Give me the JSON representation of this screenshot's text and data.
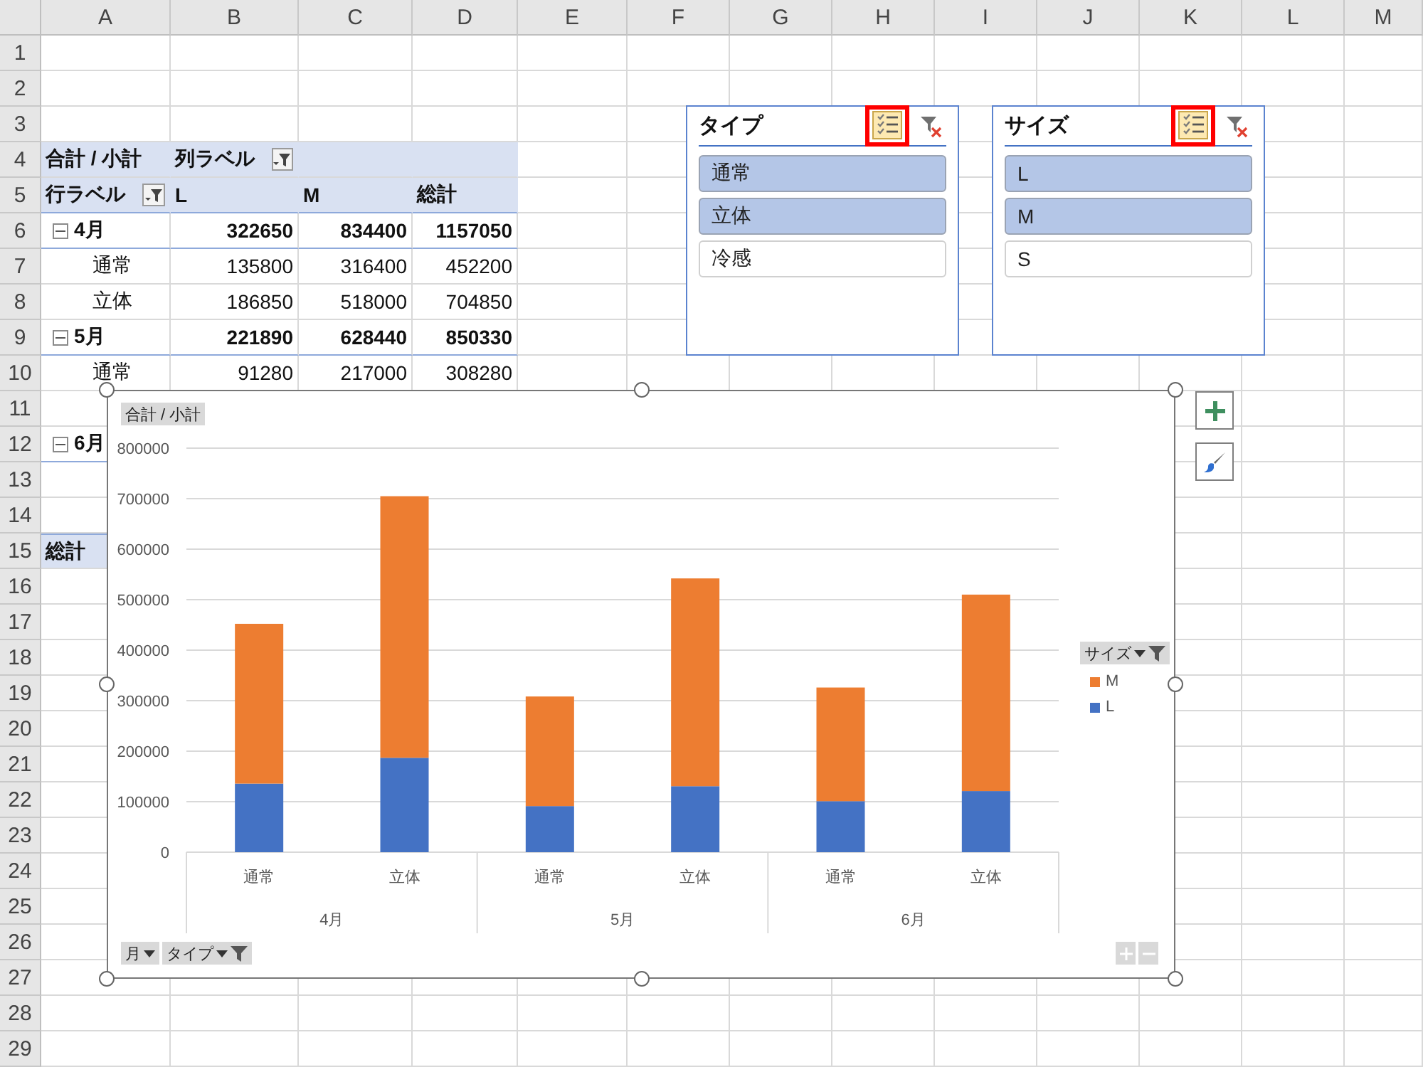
{
  "sheet": {
    "columns": [
      "A",
      "B",
      "C",
      "D",
      "E",
      "F",
      "G",
      "H",
      "I",
      "J",
      "K",
      "L",
      "M"
    ],
    "rows": [
      "1",
      "2",
      "3",
      "4",
      "5",
      "6",
      "7",
      "8",
      "9",
      "10",
      "11",
      "12",
      "13",
      "14",
      "15",
      "16",
      "17",
      "18",
      "19",
      "20",
      "21",
      "22",
      "23",
      "24",
      "25",
      "26",
      "27",
      "28",
      "29"
    ]
  },
  "pivot": {
    "value_label": "合計 / 小計",
    "column_label": "列ラベル",
    "row_label": "行ラベル",
    "columns": [
      "L",
      "M",
      "総計"
    ],
    "rows": [
      {
        "kind": "group",
        "label": "4月",
        "expanded": true,
        "values": [
          "322650",
          "834400",
          "1157050"
        ]
      },
      {
        "kind": "item",
        "label": "通常",
        "values": [
          "135800",
          "316400",
          "452200"
        ]
      },
      {
        "kind": "item",
        "label": "立体",
        "values": [
          "186850",
          "518000",
          "704850"
        ]
      },
      {
        "kind": "group",
        "label": "5月",
        "expanded": true,
        "values": [
          "221890",
          "628440",
          "850330"
        ]
      },
      {
        "kind": "item",
        "label": "通常",
        "values": [
          "91280",
          "217000",
          "308280"
        ]
      },
      {
        "kind": "item"
      },
      {
        "kind": "group",
        "label": "6月",
        "expanded": true
      },
      {
        "kind": "item"
      },
      {
        "kind": "item"
      },
      {
        "kind": "total",
        "label": "総計"
      }
    ]
  },
  "slicers": [
    {
      "title": "タイプ",
      "multi_select": true,
      "highlighted": true,
      "items": [
        {
          "label": "通常",
          "selected": true
        },
        {
          "label": "立体",
          "selected": true
        },
        {
          "label": "冷感",
          "selected": false
        }
      ]
    },
    {
      "title": "サイズ",
      "multi_select": true,
      "highlighted": true,
      "items": [
        {
          "label": "L",
          "selected": true
        },
        {
          "label": "M",
          "selected": true
        },
        {
          "label": "S",
          "selected": false
        }
      ]
    }
  ],
  "chart": {
    "field_buttons": [
      {
        "kind": "value",
        "label": "合計 / 小計",
        "dropdown": false,
        "filtered": false
      },
      {
        "kind": "legend",
        "label": "サイズ",
        "dropdown": true,
        "filtered": true
      },
      {
        "kind": "axis",
        "label": "月",
        "dropdown": true,
        "filtered": false
      },
      {
        "kind": "axis",
        "label": "タイプ",
        "dropdown": true,
        "filtered": true
      }
    ],
    "category_groups": [
      "4月",
      "5月",
      "6月"
    ],
    "chart_data": {
      "type": "bar",
      "stacked": true,
      "grid": true,
      "categories": [
        "通常",
        "立体",
        "通常",
        "立体",
        "通常",
        "立体"
      ],
      "ylim": [
        0,
        800000
      ],
      "yticks": [
        0,
        100000,
        200000,
        300000,
        400000,
        500000,
        600000,
        700000,
        800000
      ],
      "series": [
        {
          "name": "L",
          "color": "#4472c4",
          "values": [
            135800,
            186850,
            91280,
            130610,
            101000,
            121000
          ]
        },
        {
          "name": "M",
          "color": "#ed7d31",
          "values": [
            316400,
            518000,
            217000,
            411440,
            225000,
            389000
          ]
        }
      ]
    }
  }
}
